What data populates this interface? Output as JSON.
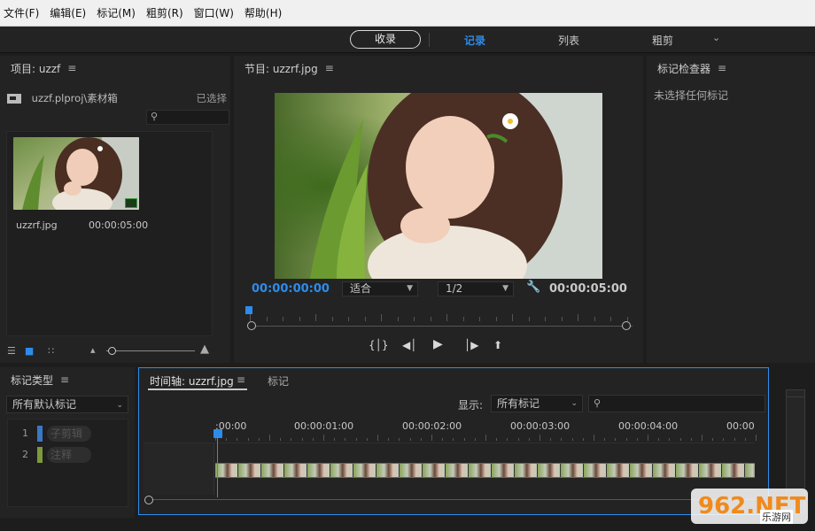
{
  "menu": [
    "文件(F)",
    "编辑(E)",
    "标记(M)",
    "粗剪(R)",
    "窗口(W)",
    "帮助(H)"
  ],
  "workspaces": {
    "assembly": "收录",
    "tabs": [
      "记录",
      "列表",
      "粗剪"
    ],
    "active": "记录"
  },
  "project": {
    "title": "项目: uzzf",
    "path": "uzzf.plproj\\素材箱",
    "selected": "已选择",
    "clip_name": "uzzrf.jpg",
    "clip_duration": "00:00:05:00"
  },
  "program": {
    "title": "节目: uzzrf.jpg",
    "timecode_in": "00:00:00:00",
    "timecode_out": "00:00:05:00",
    "fit": "适合",
    "resolution": "1/2"
  },
  "inspector": {
    "title": "标记检查器",
    "empty_text": "未选择任何标记"
  },
  "marker_types": {
    "title": "标记类型",
    "filter": "所有默认标记",
    "items": [
      {
        "num": "1",
        "label": "子剪辑",
        "color": "#3b78c4"
      },
      {
        "num": "2",
        "label": "注释",
        "color": "#7d9a3a"
      }
    ]
  },
  "timeline": {
    "tab_timeline": "时间轴: uzzrf.jpg",
    "tab_markers": "标记",
    "display_label": "显示:",
    "display_value": "所有标记",
    "times": [
      ":00:00",
      "00:00:01:00",
      "00:00:02:00",
      "00:00:03:00",
      "00:00:04:00",
      "00:00"
    ]
  },
  "watermark": {
    "text": "962.NET",
    "sub": "乐游网"
  },
  "colors": {
    "accent": "#2d8ceb",
    "panel": "#232323",
    "background": "#1d1d1d"
  }
}
